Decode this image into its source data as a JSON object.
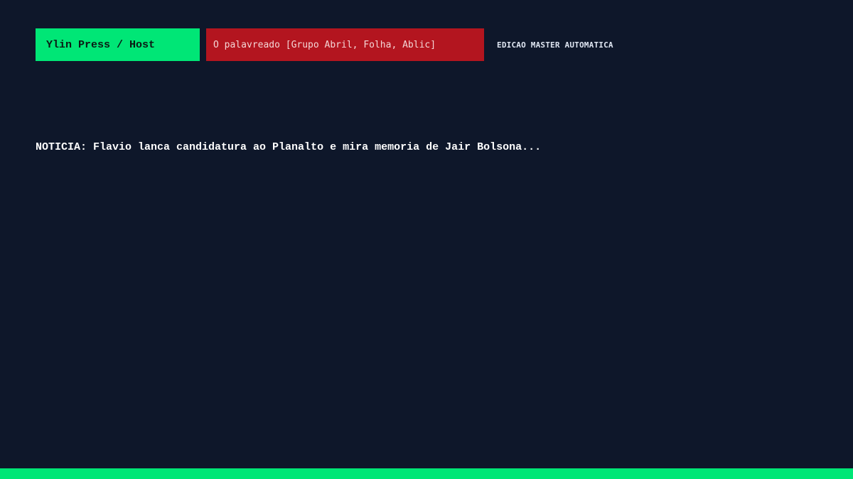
{
  "header": {
    "host_label": "Ylin Press / Host",
    "source_label": "O palavreado [Grupo Abril, Folha, Ablic]",
    "edition_label": "EDICAO MASTER AUTOMATICA"
  },
  "main": {
    "headline": "NOTICIA: Flavio lanca candidatura ao Planalto e mira memoria de Jair Bolsona..."
  },
  "colors": {
    "background": "#0e172a",
    "accent_green": "#00e676",
    "accent_red": "#b3151f"
  }
}
